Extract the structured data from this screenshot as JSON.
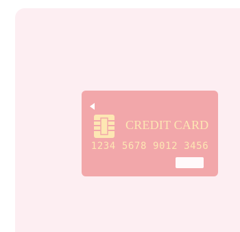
{
  "card": {
    "title": "CREDIT CARD",
    "number": "1234 5678 9012 3456",
    "colors": {
      "background": "#f2a7aa",
      "text": "#fde7b3",
      "chip": "#fde7b3",
      "panel": "#fdeef2"
    },
    "icons": [
      "back-arrow-icon",
      "chip-icon"
    ]
  }
}
